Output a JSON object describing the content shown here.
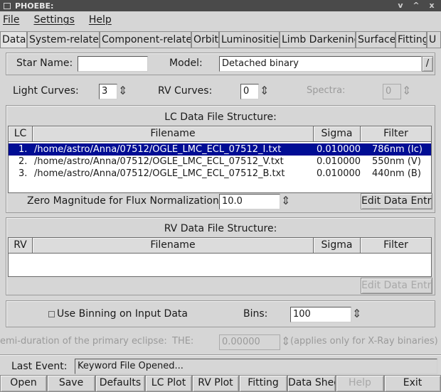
{
  "window": {
    "title": "PHOEBE:",
    "controls": [
      "v",
      "^",
      "x"
    ]
  },
  "menu": [
    "File",
    "Settings",
    "Help"
  ],
  "tabs": [
    "Data",
    "System-related",
    "Component-related",
    "Orbit",
    "Luminosities",
    "Limb Darkening",
    "Surface",
    "Fitting",
    "U"
  ],
  "star": {
    "name_label": "Star Name:",
    "name_value": "",
    "model_label": "Model:",
    "model_value": "Detached binary",
    "model_button": "/"
  },
  "counts": {
    "lc_label": "Light Curves:",
    "lc_value": "3",
    "rv_label": "RV Curves:",
    "rv_value": "0",
    "spectra_label": "Spectra:",
    "spectra_value": "0"
  },
  "lc_table": {
    "title": "LC Data File Structure:",
    "headers": [
      "LC",
      "Filename",
      "Sigma",
      "Filter"
    ],
    "rows": [
      {
        "idx": "1.",
        "file": "/home/astro/Anna/07512/OGLE_LMC_ECL_07512_I.txt",
        "sigma": "0.010000",
        "filter": "786nm (Ic)"
      },
      {
        "idx": "2.",
        "file": "/home/astro/Anna/07512/OGLE_LMC_ECL_07512_V.txt",
        "sigma": "0.010000",
        "filter": "550nm (V)"
      },
      {
        "idx": "3.",
        "file": "/home/astro/Anna/07512/OGLE_LMC_ECL_07512_B.txt",
        "sigma": "0.010000",
        "filter": "440nm (B)"
      }
    ],
    "selected_index": 0
  },
  "zero_mag": {
    "label": "Zero Magnitude for Flux Normalization:",
    "value": "10.0",
    "edit_button": "Edit Data Entry"
  },
  "rv_table": {
    "title": "RV Data File Structure:",
    "headers": [
      "RV",
      "Filename",
      "Sigma",
      "Filter"
    ],
    "edit_button": "Edit Data Entry"
  },
  "binning": {
    "checkbox_label": "Use Binning on Input Data",
    "bins_label": "Bins:",
    "bins_value": "100"
  },
  "eclipse": {
    "label": "emi-duration of the primary eclipse:",
    "the_label": "THE:",
    "the_value": "0.00000",
    "note": "(applies only for X-Ray binaries)"
  },
  "last_event": {
    "label": "Last Event:",
    "value": "Keyword File Opened..."
  },
  "bottom_buttons": [
    "Open",
    "Save",
    "Defaults",
    "LC Plot",
    "RV Plot",
    "Fitting",
    "Data Sheet",
    "Help",
    "Exit"
  ]
}
